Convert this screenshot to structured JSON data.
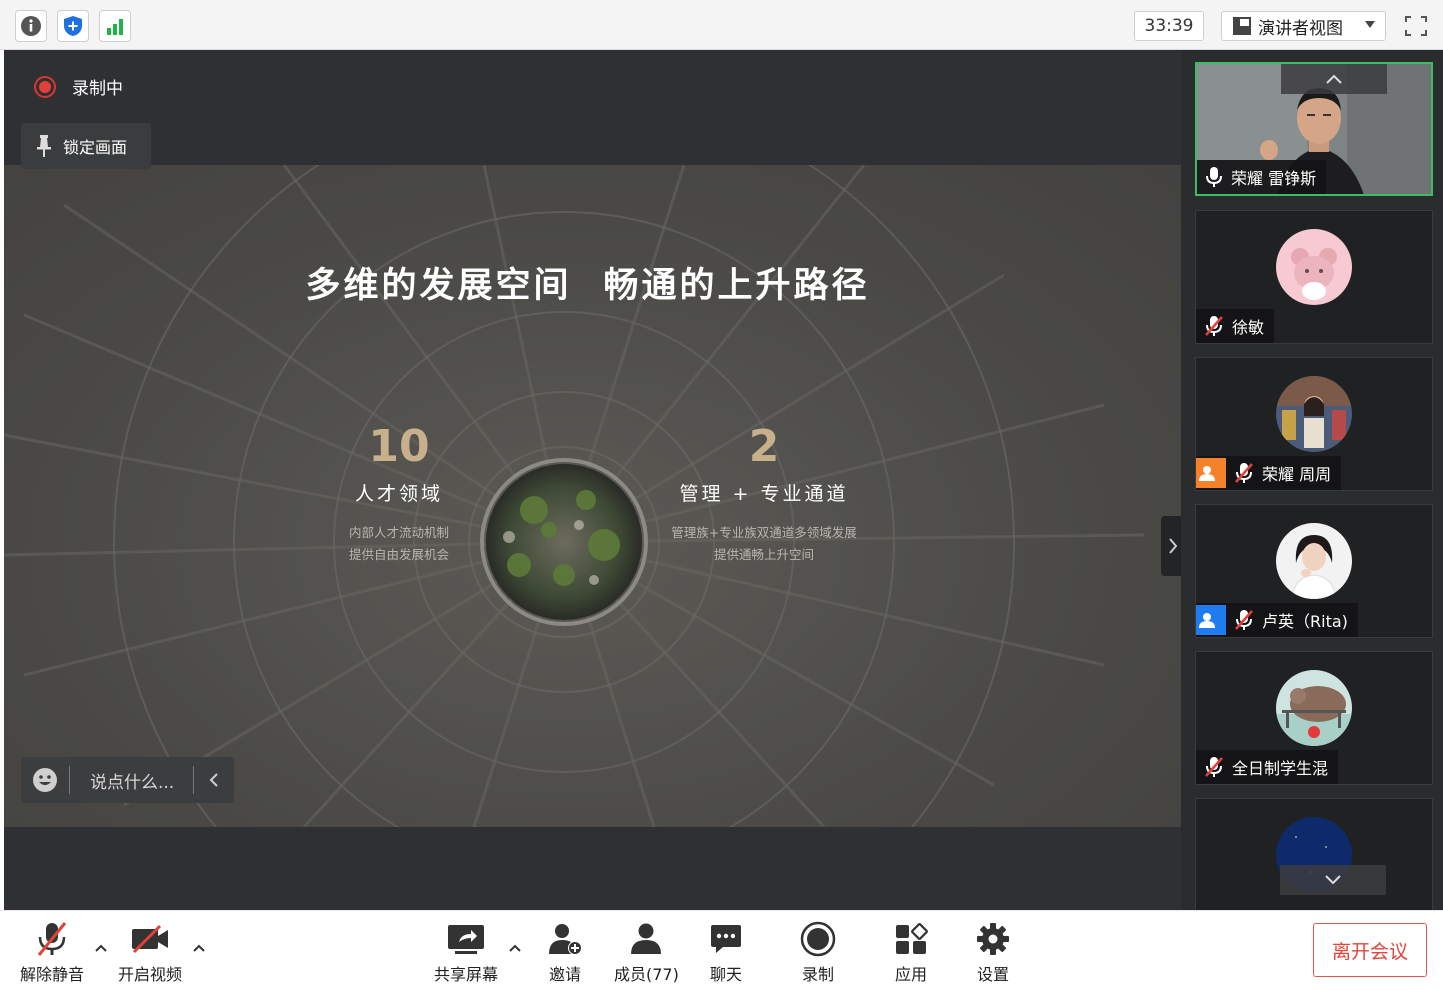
{
  "topbar": {
    "timer": "33:39",
    "view_mode": "演讲者视图",
    "icons": [
      "info-icon",
      "shield-icon",
      "signal-icon",
      "fullscreen-icon"
    ]
  },
  "stage": {
    "recording_label": "录制中",
    "lock_label": "锁定画面",
    "chat_placeholder": "说点什么...",
    "slide": {
      "title_left": "多维的发展空间",
      "title_right": "畅通的上升路径",
      "stats": [
        {
          "number": "10",
          "name": "人才领域",
          "desc_line1": "内部人才流动机制",
          "desc_line2": "提供自由发展机会"
        },
        {
          "number": "2",
          "name": "管理 + 专业通道",
          "desc_line1": "管理族+专业族双通道多领域发展",
          "desc_line2": "提供通畅上升空间"
        }
      ]
    }
  },
  "participants": [
    {
      "name": "荣耀 雷铮斯",
      "mic": "on",
      "active": true
    },
    {
      "name": "徐敏",
      "mic": "muted"
    },
    {
      "name": "荣耀 周周",
      "mic": "muted",
      "badge": "host"
    },
    {
      "name": "卢英（Rita)",
      "mic": "muted",
      "badge": "cohost"
    },
    {
      "name": "全日制学生混",
      "mic": "muted"
    },
    {
      "name": "",
      "mic": "muted"
    }
  ],
  "toolbar": {
    "unmute": "解除静音",
    "start_video": "开启视频",
    "share_screen": "共享屏幕",
    "invite": "邀请",
    "members": "成员(77)",
    "chat": "聊天",
    "record": "录制",
    "apps": "应用",
    "settings": "设置",
    "leave": "离开会议"
  },
  "colors": {
    "accent_green": "#3cbd63",
    "recording_red": "#e2403a",
    "stat_gold": "#c9b08c",
    "leave_red": "#e0443a",
    "host_orange": "#f5822a",
    "cohost_blue": "#1f7cf0"
  }
}
